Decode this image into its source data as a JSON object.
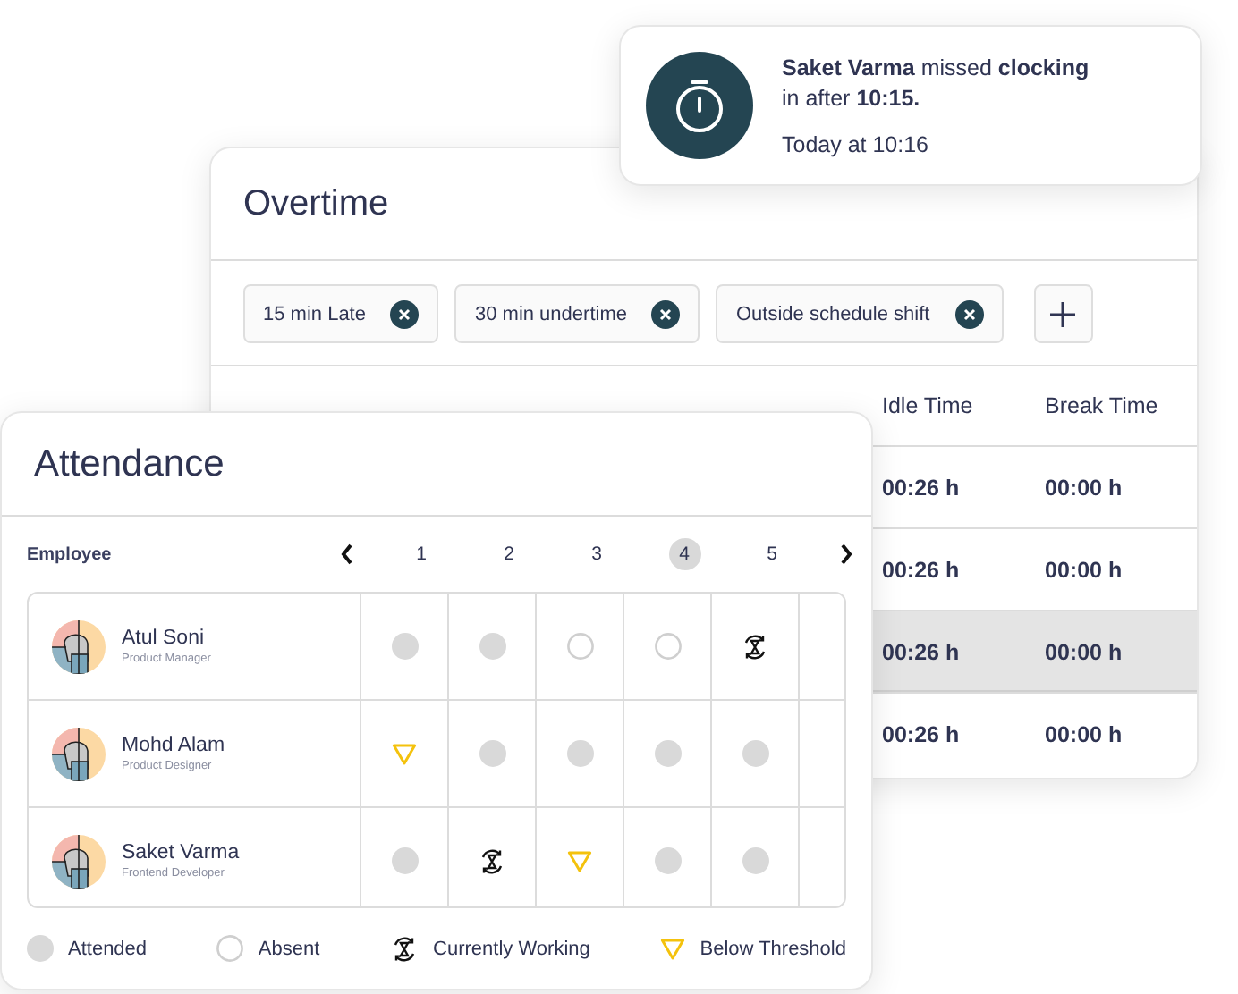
{
  "notification": {
    "message": "**Saket Varma** missed **clocking** in after **10:15.**",
    "time": "Today at 10:16"
  },
  "overtime": {
    "title": "Overtime",
    "filters": [
      {
        "label": "15 min Late"
      },
      {
        "label": "30 min undertime"
      },
      {
        "label": "Outside schedule shift"
      }
    ],
    "columns": [
      "Idle Time",
      "Break Time"
    ],
    "rows": [
      {
        "idle_time": "00:26 h",
        "break_time": "00:00 h",
        "selected": false
      },
      {
        "idle_time": "00:26 h",
        "break_time": "00:00 h",
        "selected": false
      },
      {
        "idle_time": "00:26 h",
        "break_time": "00:00 h",
        "selected": true
      },
      {
        "idle_time": "00:26 h",
        "break_time": "00:00 h",
        "selected": false
      }
    ]
  },
  "attendance": {
    "title": "Attendance",
    "employee_header": "Employee",
    "days": [
      {
        "label": "1",
        "selected": false
      },
      {
        "label": "2",
        "selected": false
      },
      {
        "label": "3",
        "selected": false
      },
      {
        "label": "4",
        "selected": true
      },
      {
        "label": "5",
        "selected": false
      }
    ],
    "employees": [
      {
        "name": "Atul Soni",
        "role": "Product Manager",
        "cells": [
          {
            "kind": "attended"
          },
          {
            "kind": "attended"
          },
          {
            "kind": "absent"
          },
          {
            "kind": "absent"
          },
          {
            "kind": "working"
          }
        ]
      },
      {
        "name": "Mohd Alam",
        "role": "Product Designer",
        "cells": [
          {
            "kind": "below"
          },
          {
            "kind": "attended"
          },
          {
            "kind": "attended"
          },
          {
            "kind": "attended"
          },
          {
            "kind": "attended"
          }
        ]
      },
      {
        "name": "Saket Varma",
        "role": "Frontend Developer",
        "cells": [
          {
            "kind": "attended"
          },
          {
            "kind": "working"
          },
          {
            "kind": "below"
          },
          {
            "kind": "attended"
          },
          {
            "kind": "attended"
          }
        ]
      }
    ],
    "legend": [
      {
        "kind": "attended",
        "label": "Attended"
      },
      {
        "kind": "absent",
        "label": "Absent"
      },
      {
        "kind": "working",
        "label": "Currently Working"
      },
      {
        "kind": "below",
        "label": "Below Threshold"
      }
    ]
  }
}
